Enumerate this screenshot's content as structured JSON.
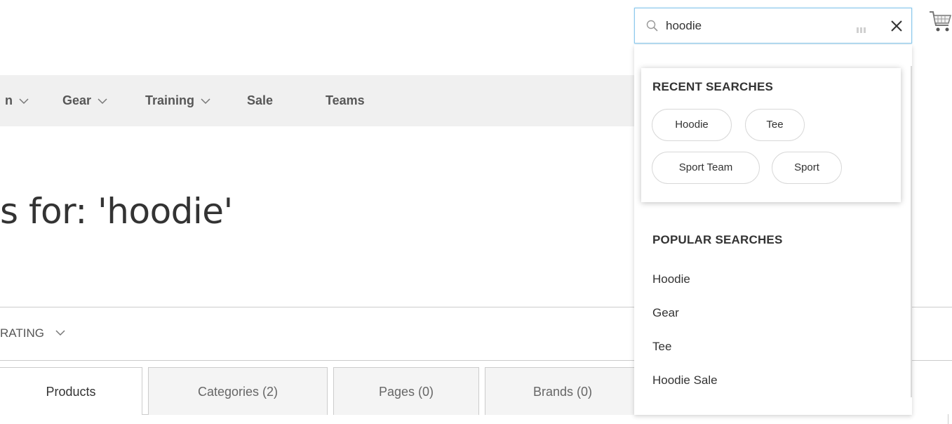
{
  "nav": {
    "items": [
      {
        "label": "n",
        "has_chevron": true
      },
      {
        "label": "Gear",
        "has_chevron": true
      },
      {
        "label": "Training",
        "has_chevron": true
      },
      {
        "label": "Sale",
        "has_chevron": false
      },
      {
        "label": "Teams",
        "has_chevron": false
      }
    ]
  },
  "page": {
    "title": "s for: 'hoodie'"
  },
  "filter": {
    "rating_label": "RATING"
  },
  "tabs": [
    {
      "label": "Products",
      "active": true
    },
    {
      "label": "Categories (2)",
      "active": false
    },
    {
      "label": "Pages (0)",
      "active": false
    },
    {
      "label": "Brands (0)",
      "active": false
    }
  ],
  "search": {
    "value": "hoodie",
    "icon": "search-icon",
    "clear_icon": "close-icon",
    "loader_icon": "loading-dots-icon",
    "accent_border": "#8ec9ec"
  },
  "cart": {
    "icon": "shopping-cart-icon"
  },
  "autocomplete": {
    "recent": {
      "title": "RECENT SEARCHES",
      "items": [
        "Hoodie",
        "Tee",
        "Sport Team",
        "Sport"
      ]
    },
    "popular": {
      "title": "POPULAR SEARCHES",
      "items": [
        "Hoodie",
        "Gear",
        "Tee",
        "Hoodie Sale"
      ]
    }
  }
}
